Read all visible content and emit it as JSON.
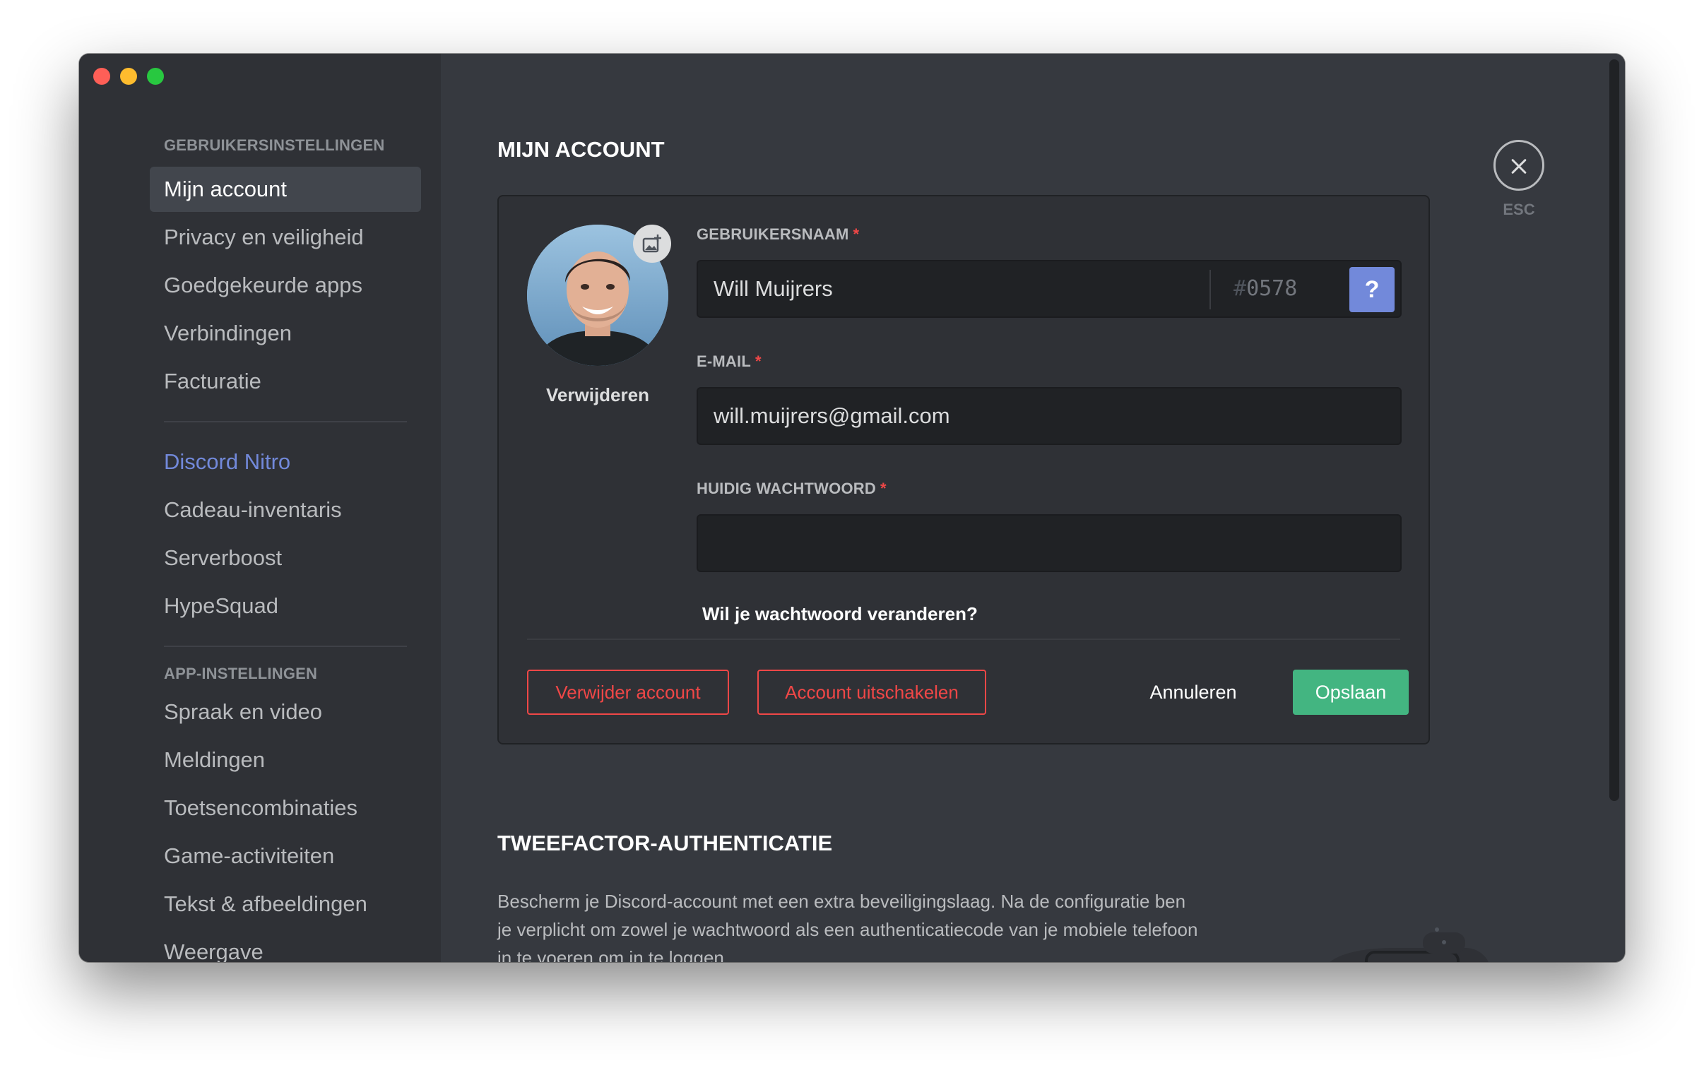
{
  "sidebar": {
    "user_settings_header": "GEBRUIKERSINSTELLINGEN",
    "user_items": [
      {
        "label": "Mijn account"
      },
      {
        "label": "Privacy en veiligheid"
      },
      {
        "label": "Goedgekeurde apps"
      },
      {
        "label": "Verbindingen"
      },
      {
        "label": "Facturatie"
      }
    ],
    "nitro_items": [
      {
        "label": "Discord Nitro"
      },
      {
        "label": "Cadeau-inventaris"
      },
      {
        "label": "Serverboost"
      },
      {
        "label": "HypeSquad"
      }
    ],
    "app_settings_header": "APP-INSTELLINGEN",
    "app_items": [
      {
        "label": "Spraak en video"
      },
      {
        "label": "Meldingen"
      },
      {
        "label": "Toetsencombinaties"
      },
      {
        "label": "Game-activiteiten"
      },
      {
        "label": "Tekst & afbeeldingen"
      },
      {
        "label": "Weergave"
      }
    ]
  },
  "main": {
    "title": "MIJN ACCOUNT",
    "close_label": "ESC",
    "account": {
      "remove_avatar": "Verwijderen",
      "username_label": "GEBRUIKERSNAAM",
      "username_value": "Will Muijrers",
      "discriminator_hash": "#",
      "discriminator": "0578",
      "help_label": "?",
      "email_label": "E-MAIL",
      "email_value": "will.muijrers@gmail.com",
      "password_label": "HUIDIG WACHTWOORD",
      "password_value": "",
      "required_mark": "*",
      "change_password": "Wil je wachtwoord veranderen?",
      "delete_account": "Verwijder account",
      "disable_account": "Account uitschakelen",
      "cancel": "Annuleren",
      "save": "Opslaan"
    },
    "two_factor": {
      "title": "TWEEFACTOR-AUTHENTICATIE",
      "description": "Bescherm je Discord-account met een extra beveiligingslaag. Na de configuratie ben je verplicht om zowel je wachtwoord als een authenticatiecode van je mobiele telefoon in te voeren om in te loggen."
    }
  },
  "colors": {
    "accent": "#7289da",
    "danger": "#f04747",
    "success": "#43b581",
    "background": "#36393f",
    "sidebar": "#2f3136"
  },
  "icons": {
    "avatar_edit": "image-add-icon",
    "close": "close-icon"
  }
}
